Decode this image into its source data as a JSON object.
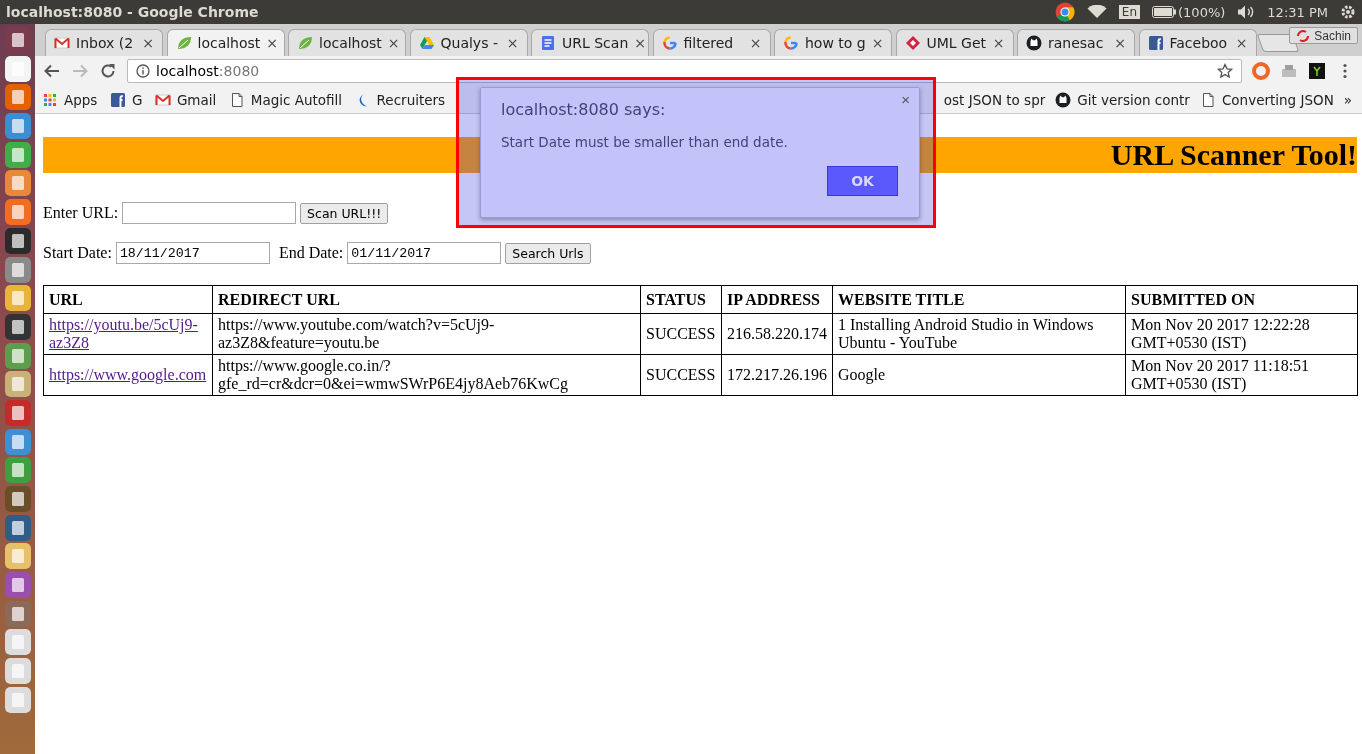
{
  "panel": {
    "title": "localhost:8080 - Google Chrome",
    "keyboard": "En",
    "battery": "(100%)",
    "time": "12:31 PM"
  },
  "tabs": [
    {
      "title": "Inbox (2",
      "kind": "mail",
      "close": "×",
      "selected": false
    },
    {
      "title": "localhost",
      "kind": "leaf",
      "close": "×",
      "selected": true
    },
    {
      "title": "localhost",
      "kind": "leaf",
      "close": "×",
      "selected": false
    },
    {
      "title": "Qualys -",
      "kind": "triangle",
      "close": "×",
      "selected": false
    },
    {
      "title": "URL Scan",
      "kind": "doc",
      "close": "×",
      "selected": false
    },
    {
      "title": "filtered",
      "kind": "ring",
      "close": "×",
      "selected": false
    },
    {
      "title": "how to g",
      "kind": "ring",
      "close": "×",
      "selected": false
    },
    {
      "title": "UML Get",
      "kind": "diamond",
      "close": "×",
      "selected": false
    },
    {
      "title": "ranesac",
      "kind": "cat",
      "close": "×",
      "selected": false
    },
    {
      "title": "Faceboo",
      "kind": "square",
      "close": "×",
      "selected": false
    }
  ],
  "profile": "Sachin",
  "address": {
    "host": "localhost",
    "port": ":8080"
  },
  "bookmarks": [
    {
      "label": "Apps",
      "kind": "apps"
    },
    {
      "label": "G",
      "kind": "square"
    },
    {
      "label": "Gmail",
      "kind": "mail"
    },
    {
      "label": "Magic Autofill",
      "kind": "page"
    },
    {
      "label": "Recruiters",
      "kind": "moon"
    }
  ],
  "bookmarks_right": [
    {
      "label": "ost JSON to spr",
      "kind": "plain"
    },
    {
      "label": "Git version contr",
      "kind": "cat"
    },
    {
      "label": "Converting JSON",
      "kind": "page"
    }
  ],
  "bookmarks_more": "»",
  "page": {
    "heading": "URL Scanner Tool!",
    "url_label": "Enter URL:",
    "scan_button": "Scan URL!!!",
    "start_label": "Start Date:",
    "start_value": "18/11/2017",
    "end_label": "End Date:",
    "end_value": "01/11/2017",
    "search_button": "Search Urls"
  },
  "table": {
    "columns": [
      "URL",
      "REDIRECT URL",
      "STATUS",
      "IP ADDRESS",
      "WEBSITE TITLE",
      "SUBMITTED ON"
    ],
    "rows": [
      {
        "url": "https://youtu.be/5cUj9-az3Z8",
        "redirect_url": "https://www.youtube.com/watch?v=5cUj9-az3Z8&feature=youtu.be",
        "status": "SUCCESS",
        "ip_address": "216.58.220.174",
        "website_title": "1 Installing Android Studio in Windows Ubuntu - YouTube",
        "submitted_on": "Mon Nov 20 2017 12:22:28 GMT+0530 (IST)"
      },
      {
        "url": "https://www.google.com",
        "redirect_url": "https://www.google.co.in/?gfe_rd=cr&dcr=0&ei=wmwSWrP6E4jy8Aeb76KwCg",
        "status": "SUCCESS",
        "ip_address": "172.217.26.196",
        "website_title": "Google",
        "submitted_on": "Mon Nov 20 2017 11:18:51 GMT+0530 (IST)"
      }
    ]
  },
  "dialog": {
    "title": "localhost:8080 says:",
    "message": "Start Date must be smaller than end date.",
    "ok": "OK",
    "close": "×"
  }
}
